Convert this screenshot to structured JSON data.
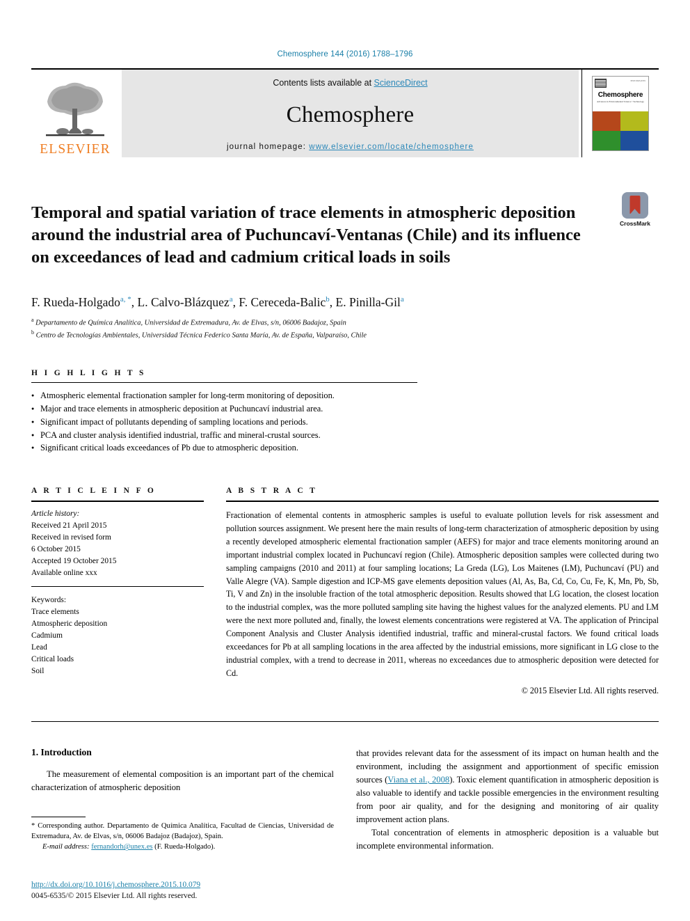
{
  "running_head": "Chemosphere 144 (2016) 1788–1796",
  "masthead": {
    "publisher_logo_text": "ELSEVIER",
    "contents_prefix": "Contents lists available at ",
    "contents_link": "ScienceDirect",
    "journal_name": "Chemosphere",
    "homepage_prefix": "journal homepage: ",
    "homepage_url": "www.elsevier.com/locate/chemosphere",
    "cover": {
      "title": "Chemosphere",
      "subtitle": "Advances in Environmental Science • Technology",
      "code": "ISSN 0045-6535",
      "swatches": [
        "#b5471b",
        "#b3ba1c",
        "#2f8f2c",
        "#1f4f9c"
      ]
    }
  },
  "article": {
    "title": "Temporal and spatial variation of trace elements in atmospheric deposition around the industrial area of Puchuncaví-Ventanas (Chile) and its influence on exceedances of lead and cadmium critical loads in soils",
    "crossmark_label": "CrossMark",
    "authors": [
      {
        "name": "F. Rueda-Holgado",
        "marks": "a, *"
      },
      {
        "name": "L. Calvo-Blázquez",
        "marks": "a"
      },
      {
        "name": "F. Cereceda-Balic",
        "marks": "b"
      },
      {
        "name": "E. Pinilla-Gil",
        "marks": "a"
      }
    ],
    "affiliations": [
      {
        "mark": "a",
        "text": "Departamento de Química Analítica, Universidad de Extremadura, Av. de Elvas, s/n, 06006 Badajoz, Spain"
      },
      {
        "mark": "b",
        "text": "Centro de Tecnologías Ambientales, Universidad Técnica Federico Santa María, Av. de España, Valparaíso, Chile"
      }
    ]
  },
  "highlights": {
    "heading": "H I G H L I G H T S",
    "items": [
      "Atmospheric elemental fractionation sampler for long-term monitoring of deposition.",
      "Major and trace elements in atmospheric deposition at Puchuncaví industrial area.",
      "Significant impact of pollutants depending of sampling locations and periods.",
      "PCA and cluster analysis identified industrial, traffic and mineral-crustal sources.",
      "Significant critical loads exceedances of Pb due to atmospheric deposition."
    ]
  },
  "article_info": {
    "heading": "A R T I C L E   I N F O",
    "history_label": "Article history:",
    "history_lines": [
      "Received 21 April 2015",
      "Received in revised form",
      "6 October 2015",
      "Accepted 19 October 2015",
      "Available online xxx"
    ],
    "keywords_label": "Keywords:",
    "keywords": [
      "Trace elements",
      "Atmospheric deposition",
      "Cadmium",
      "Lead",
      "Critical loads",
      "Soil"
    ]
  },
  "abstract": {
    "heading": "A B S T R A C T",
    "text": "Fractionation of elemental contents in atmospheric samples is useful to evaluate pollution levels for risk assessment and pollution sources assignment. We present here the main results of long-term characterization of atmospheric deposition by using a recently developed atmospheric elemental fractionation sampler (AEFS) for major and trace elements monitoring around an important industrial complex located in Puchuncaví region (Chile). Atmospheric deposition samples were collected during two sampling campaigns (2010 and 2011) at four sampling locations; La Greda (LG), Los Maitenes (LM), Puchuncaví (PU) and Valle Alegre (VA). Sample digestion and ICP-MS gave elements deposition values (Al, As, Ba, Cd, Co, Cu, Fe, K, Mn, Pb, Sb, Ti, V and Zn) in the insoluble fraction of the total atmospheric deposition. Results showed that LG location, the closest location to the industrial complex, was the more polluted sampling site having the highest values for the analyzed elements. PU and LM were the next more polluted and, finally, the lowest elements concentrations were registered at VA. The application of Principal Component Analysis and Cluster Analysis identified industrial, traffic and mineral-crustal factors. We found critical loads exceedances for Pb at all sampling locations in the area affected by the industrial emissions, more significant in LG close to the industrial complex, with a trend to decrease in 2011, whereas no exceedances due to atmospheric deposition were detected for Cd.",
    "copyright": "© 2015 Elsevier Ltd. All rights reserved."
  },
  "body": {
    "intro_heading": "1. Introduction",
    "left_para_1": "The measurement of elemental composition is an important part of the chemical characterization of atmospheric deposition",
    "right_para_1_a": "that provides relevant data for the assessment of its impact on human health and the environment, including the assignment and apportionment of specific emission sources (",
    "right_para_1_link": "Viana et al., 2008",
    "right_para_1_b": "). Toxic element quantification in atmospheric deposition is also valuable to identify and tackle possible emergencies in the environment resulting from poor air quality, and for the designing and monitoring of air quality improvement action plans.",
    "right_para_2": "Total concentration of elements in atmospheric deposition is a valuable but incomplete environmental information."
  },
  "footer": {
    "corresponding_star": "*",
    "corresponding_text": " Corresponding author. Departamento de Química Analítica, Facultad de Ciencias, Universidad de Extremadura, Av. de Elvas, s/n, 06006 Badajoz (Badajoz), Spain.",
    "email_label": "E-mail address:",
    "email_value": "fernandorh@unex.es",
    "email_owner": " (F. Rueda-Holgado).",
    "doi": "http://dx.doi.org/10.1016/j.chemosphere.2015.10.079",
    "issn": "0045-6535/© 2015 Elsevier Ltd. All rights reserved."
  }
}
